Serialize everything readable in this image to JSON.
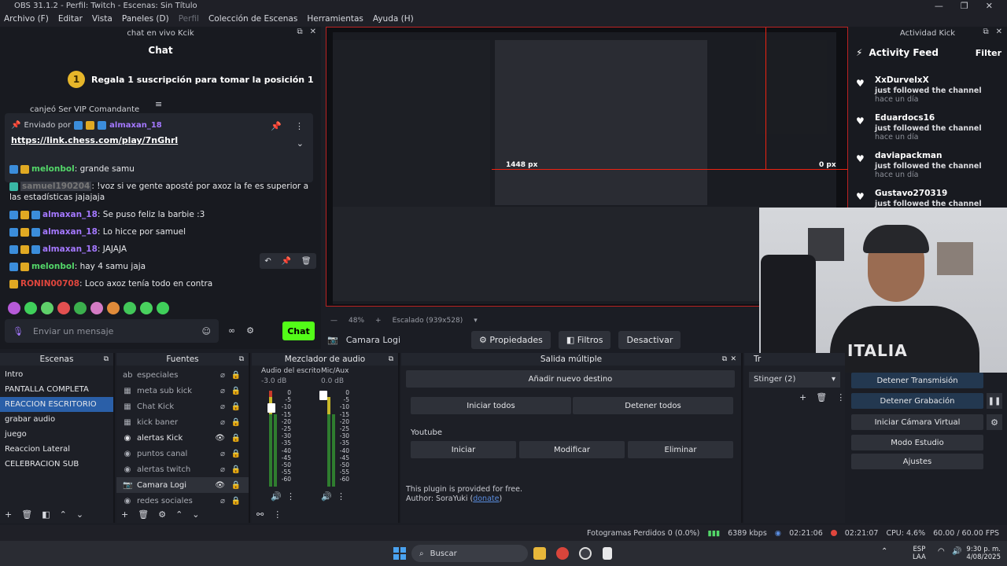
{
  "titlebar": {
    "title": "OBS 31.1.2 - Perfil: Twitch - Escenas: Sin Título"
  },
  "menu": [
    "Archivo (F)",
    "Editar",
    "Vista",
    "Paneles (D)",
    "Perfil",
    "Colección de Escenas",
    "Herramientas",
    "Ayuda (H)"
  ],
  "chat": {
    "dock_title": "chat en vivo Kcik",
    "title": "Chat",
    "goal_rank": "1",
    "goal_text": "Regala 1 suscripción para tomar la posición 1",
    "partial_text": "canjeó Ser VIP Comandante",
    "pinned_sender_prefix": "Enviado por",
    "pinned_sender": "almaxan_18",
    "pinned_link": "https://link.chess.com/play/7nGhrl",
    "messages": [
      {
        "user": "melonbol",
        "text": ": grande samu",
        "color": "green"
      },
      {
        "user": "samuel190204",
        "text": ": !voz si ve gente aposté por axoz la fe es superior a las estadísticas jajajaja",
        "color": "gray"
      },
      {
        "user": "almaxan_18",
        "text": ": Se puso feliz la barbie :3",
        "color": "purple"
      },
      {
        "user": "almaxan_18",
        "text": ": Lo hicce por samuel",
        "color": "purple"
      },
      {
        "user": "almaxan_18",
        "text": ": JAJAJA",
        "color": "purple"
      },
      {
        "user": "melonbol",
        "text": ": hay 4 samu jaja",
        "color": "green"
      },
      {
        "user": "RONIN00708",
        "text": ": Loco axoz tenía todo en contra",
        "color": "red"
      }
    ],
    "placeholder": "Enviar un mensaje",
    "send_label": "Chat"
  },
  "preview": {
    "width_label": "1448 px",
    "offset_label": "0 px",
    "zoom": "48%",
    "scale": "Escalado (939x528)"
  },
  "activity": {
    "dock_title": "Actividad Kick",
    "title": "Activity Feed",
    "filter": "Filter",
    "items": [
      {
        "name": "XxDurvelxX",
        "desc": "just followed the channel",
        "ago": "hace un día"
      },
      {
        "name": "Eduardocs16",
        "desc": "just followed the channel",
        "ago": "hace un día"
      },
      {
        "name": "daviapackman",
        "desc": "just followed the channel",
        "ago": "hace un día"
      },
      {
        "name": "Gustavo270319",
        "desc": "just followed the channel",
        "ago": "hace un"
      }
    ]
  },
  "webcam": {
    "shirt_text": "ITALIA"
  },
  "propbar": {
    "source": "Camara Logi",
    "properties": "Propiedades",
    "filters": "Filtros",
    "deactivate": "Desactivar"
  },
  "scenes": {
    "title": "Escenas",
    "items": [
      "Intro",
      "PANTALLA COMPLETA",
      "REACCION ESCRITORIO",
      "grabar audio",
      "juego",
      "Reaccion Lateral",
      "CELEBRACION SUB"
    ],
    "selected": 2
  },
  "sources": {
    "title": "Fuentes",
    "items": [
      "especiales",
      "meta sub kick",
      "Chat Kick",
      "kick baner",
      "alertas Kick",
      "puntos canal",
      "alertas twitch",
      "Camara Logi",
      "redes sociales"
    ]
  },
  "mixer": {
    "title": "Mezclador de audio",
    "channels": [
      {
        "name": "Audio del escrito",
        "db": "-3.0 dB"
      },
      {
        "name": "Mic/Aux",
        "db": "0.0 dB"
      }
    ],
    "scale": [
      "0",
      "-5",
      "-10",
      "-15",
      "-20",
      "-25",
      "-30",
      "-35",
      "-40",
      "-45",
      "-50",
      "-55",
      "-60"
    ]
  },
  "multi": {
    "title": "Salida múltiple",
    "add": "Añadir nuevo destino",
    "start_all": "Iniciar todos",
    "stop_all": "Detener todos",
    "target": "Youtube",
    "start": "Iniciar",
    "modify": "Modificar",
    "delete": "Eliminar",
    "note1": "This plugin is provided for free.",
    "note2_prefix": "Author: SoraYuki (",
    "note2_link": "donate",
    "note2_suffix": ")"
  },
  "transitions": {
    "tab": "Tr",
    "value": "Stinger (2)"
  },
  "controls": {
    "stop_stream": "Detener Transmisión",
    "stop_record": "Detener Grabación",
    "virtual_cam": "Iniciar Cámara Virtual",
    "studio": "Modo Estudio",
    "settings": "Ajustes"
  },
  "status": {
    "dropped": "Fotogramas Perdidos 0 (0.0%)",
    "kbps": "6389 kbps",
    "stream_time": "02:21:06",
    "rec_time": "02:21:07",
    "cpu": "CPU: 4.6%",
    "fps": "60.00 / 60.00 FPS"
  },
  "taskbar": {
    "search": "Buscar",
    "lang1": "ESP",
    "lang2": "LAA",
    "time": "9:30 p. m.",
    "date": "4/08/2025"
  }
}
